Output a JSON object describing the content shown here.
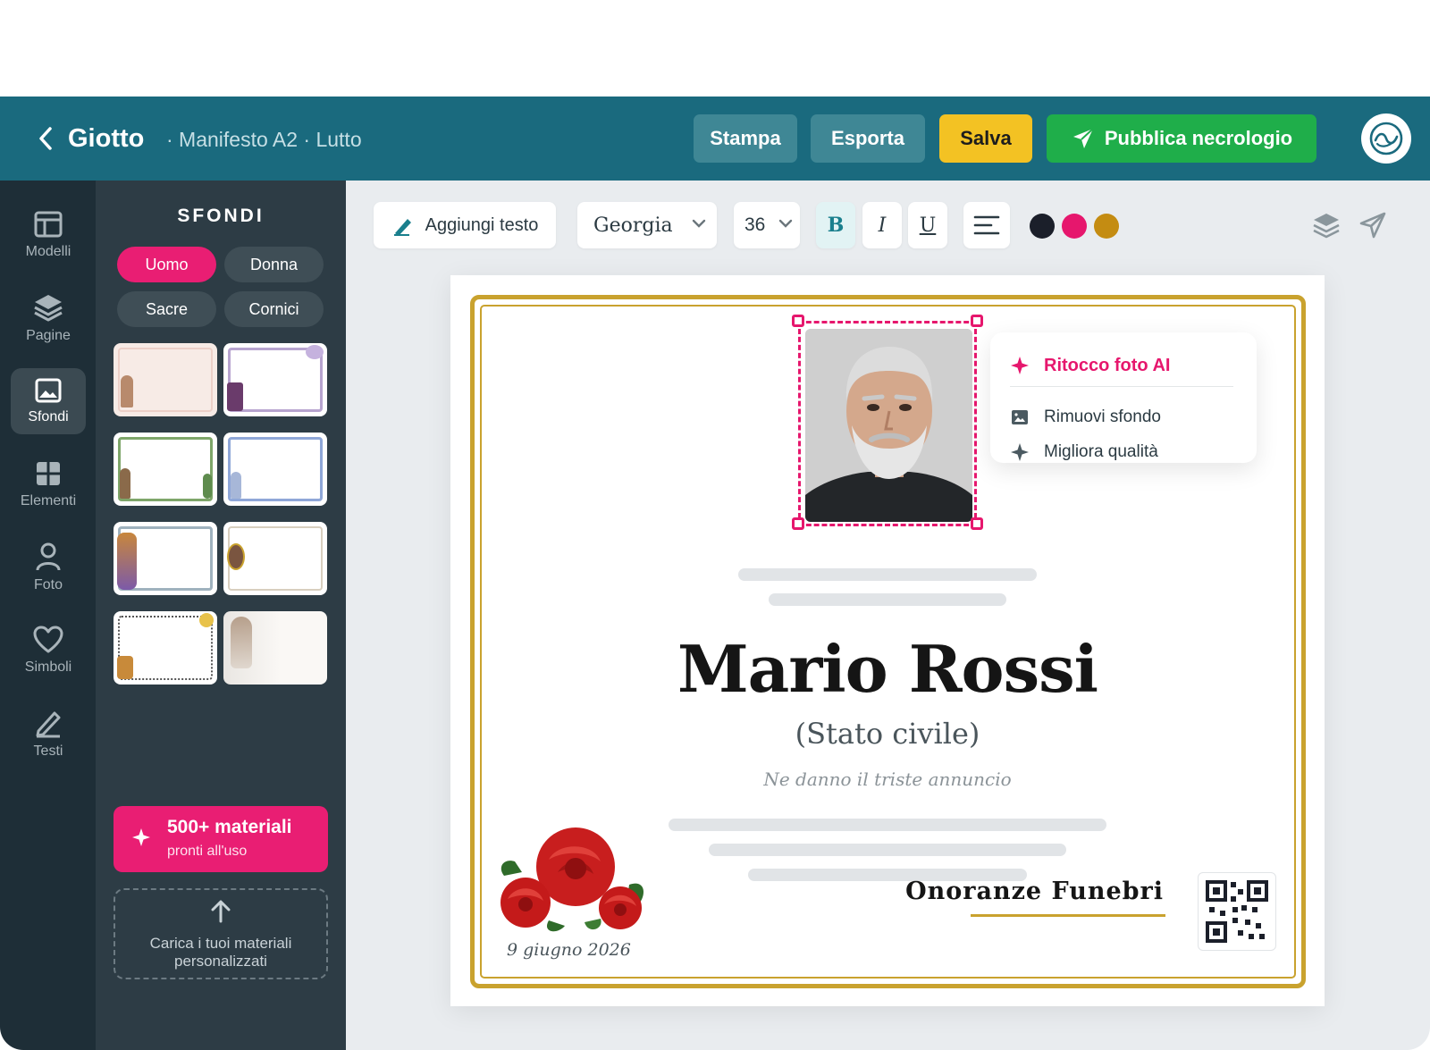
{
  "header": {
    "app_title": "Giotto",
    "document_title": "· Manifesto A2 · Lutto",
    "buttons": {
      "stampa": "Stampa",
      "esporta": "Esporta",
      "salva": "Salva",
      "pubblica": "Pubblica necrologio"
    }
  },
  "rail": {
    "items": [
      {
        "label": "Modelli",
        "icon": "layout-icon"
      },
      {
        "label": "Pagine",
        "icon": "layers-icon"
      },
      {
        "label": "Sfondi",
        "icon": "image-icon",
        "active": true
      },
      {
        "label": "Elementi",
        "icon": "grid-icon"
      },
      {
        "label": "Foto",
        "icon": "person-icon"
      },
      {
        "label": "Simboli",
        "icon": "heart-icon"
      },
      {
        "label": "Testi",
        "icon": "pen-icon"
      }
    ]
  },
  "panel": {
    "title": "SFONDI",
    "filters": [
      {
        "label": "Uomo",
        "active": true
      },
      {
        "label": "Donna"
      },
      {
        "label": "Sacre"
      },
      {
        "label": "Cornici"
      }
    ],
    "promo": {
      "title": "500+ materiali",
      "subtitle": "pronti all'uso"
    },
    "upload": {
      "line1": "Carica i tuoi materiali",
      "line2": "personalizzati"
    }
  },
  "toolbar": {
    "add_text": "Aggiungi testo",
    "font": "Georgia",
    "size": "36",
    "bold": "B",
    "italic": "I",
    "underline": "U",
    "colors": [
      "#1b1f2a",
      "#e6176d",
      "#c48c12"
    ]
  },
  "canvas": {
    "ai_menu": {
      "title": "Ritocco foto AI",
      "items": [
        "Rimuovi sfondo",
        "Migliora qualità"
      ]
    },
    "name": "Mario Rossi",
    "civil_status": "(Stato civile)",
    "announcement": "Ne danno il triste annuncio",
    "funeral_home": "Onoranze Funebri",
    "date": "9 giugno 2026"
  },
  "colors": {
    "header": "#1a6a7e",
    "accent_pink": "#e91e73",
    "save_yellow": "#f3c223",
    "publish_green": "#1fae4a",
    "gold_border": "#c9a22e"
  }
}
